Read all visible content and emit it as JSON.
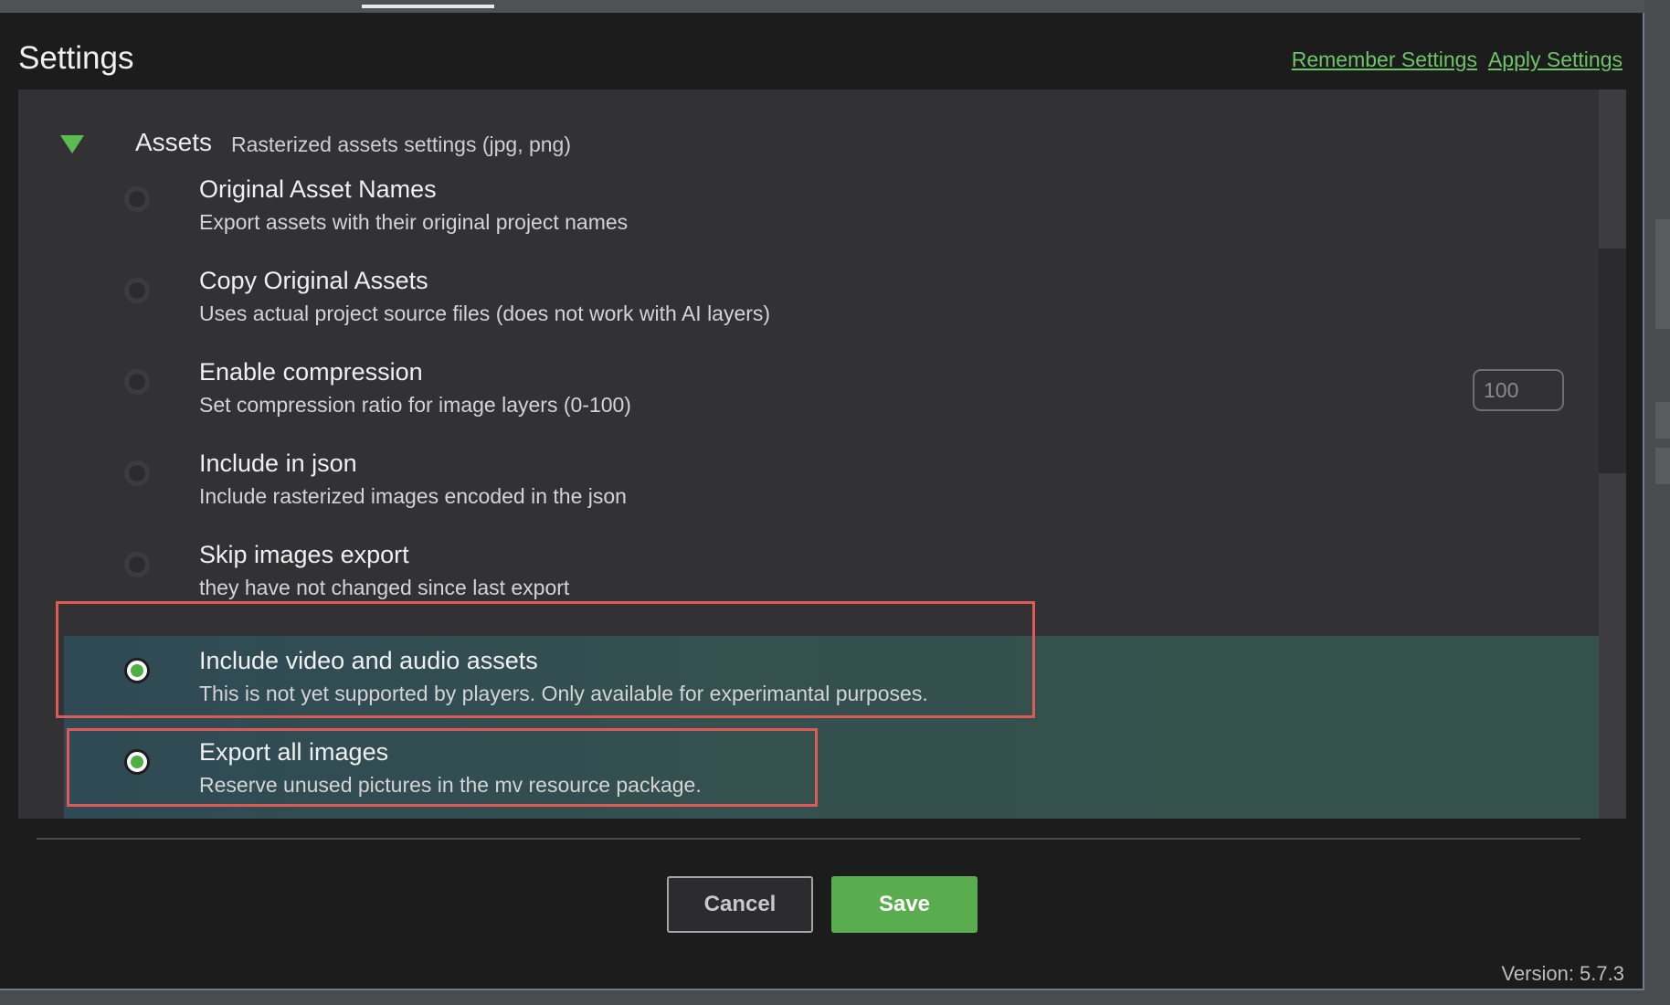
{
  "dialog": {
    "title": "Settings",
    "links": {
      "remember": "Remember Settings",
      "apply": "Apply Settings"
    },
    "version": "Version: 5.7.3"
  },
  "section": {
    "title": "Assets",
    "subtitle": "Rasterized assets settings (jpg, png)",
    "expanded": true,
    "toggle_icon": "triangle-down-icon"
  },
  "options": [
    {
      "label": "Original Asset Names",
      "description": "Export assets with their original project names",
      "checked": false
    },
    {
      "label": "Copy Original Assets",
      "description": "Uses actual project source files (does not work with AI layers)",
      "checked": false
    },
    {
      "label": "Enable compression",
      "description": "Set compression ratio for image layers (0-100)",
      "checked": false
    },
    {
      "label": "Include in json",
      "description": "Include rasterized images encoded in the json",
      "checked": false
    },
    {
      "label": "Skip images export",
      "description": "they have not changed since last export",
      "checked": false
    },
    {
      "label": "Include video and audio assets",
      "description": "This is not yet supported by players. Only available for experimantal purposes.",
      "checked": true
    },
    {
      "label": "Export all images",
      "description": "Reserve unused pictures in the mv resource package.",
      "checked": true
    }
  ],
  "compression": {
    "placeholder": "100"
  },
  "buttons": {
    "cancel": "Cancel",
    "save": "Save"
  },
  "colors": {
    "accent": "#5aad4e",
    "link": "#6ec468",
    "highlight": "#e05a55",
    "background": "#1c1c1d",
    "panel": "#323234"
  }
}
